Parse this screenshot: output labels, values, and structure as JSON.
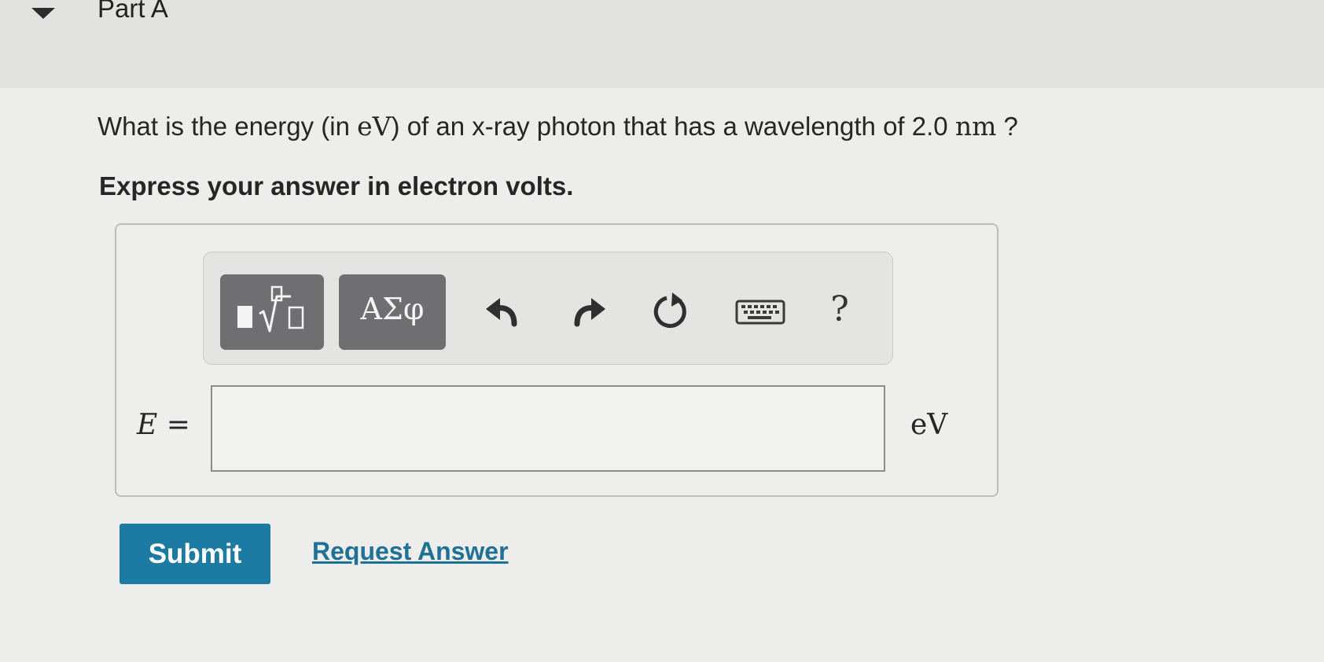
{
  "part": {
    "title": "Part A"
  },
  "question": {
    "prefix": "What is the energy (in ",
    "unit_energy": "eV",
    "middle": ") of an x-ray photon that has a wavelength of 2.0 ",
    "unit_length": "nm",
    "suffix": " ?"
  },
  "instruction": "Express your answer in electron volts.",
  "toolbar": {
    "templates_icon": "fraction-root-template-icon",
    "greek_label": "ΑΣφ",
    "undo_icon": "undo-icon",
    "redo_icon": "redo-icon",
    "reset_icon": "reset-icon",
    "keyboard_icon": "keyboard-icon",
    "help_label": "?"
  },
  "answer": {
    "variable": "E",
    "equals": " =",
    "value": "",
    "unit": "eV"
  },
  "actions": {
    "submit_label": "Submit",
    "request_answer_label": "Request Answer"
  },
  "colors": {
    "primary": "#1d7ba3",
    "link": "#1f7196",
    "toolbar_button": "#6f6f71"
  }
}
